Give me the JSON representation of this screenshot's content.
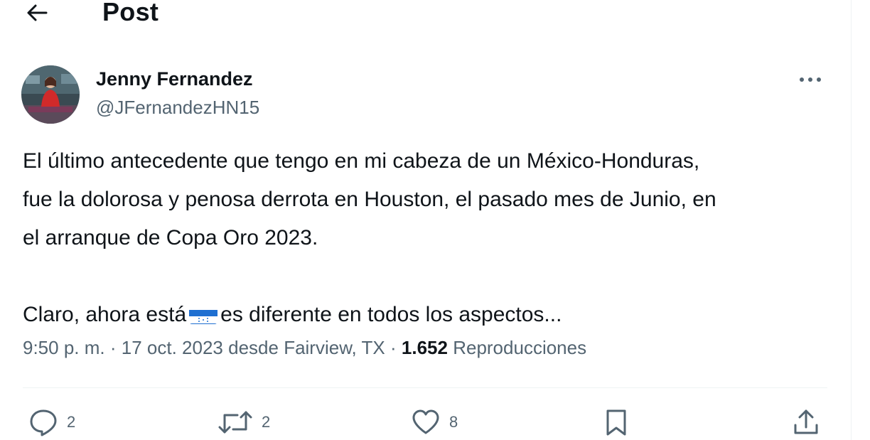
{
  "header": {
    "back_icon": "arrow-left-icon",
    "title": "Post"
  },
  "author": {
    "avatar_icon": "avatar-photo",
    "name": "Jenny Fernandez",
    "handle": "@JFernandezHN15"
  },
  "more_icon": "more-horizontal-icon",
  "tweet": {
    "line1": "El último antecedente que tengo en mi cabeza de un México-Honduras,",
    "line2": "fue la dolorosa y penosa derrota en Houston, el pasado mes de Junio, en",
    "line3": "el arranque de Copa Oro 2023.",
    "line4_before_flag": "Claro, ahora está",
    "flag_icon": "honduras-flag-emoji",
    "line4_after_flag": "es diferente en todos los aspectos..."
  },
  "meta": {
    "time": "9:50 p. m.",
    "separator": "·",
    "date": "17 oct. 2023",
    "source": "desde Fairview, TX",
    "views_count": "1.652",
    "views_label": "Reproducciones"
  },
  "actions": {
    "reply": {
      "icon": "reply-icon",
      "count": "2"
    },
    "repost": {
      "icon": "repost-icon",
      "count": "2"
    },
    "like": {
      "icon": "heart-icon",
      "count": "8"
    },
    "bookmark": {
      "icon": "bookmark-icon"
    },
    "share": {
      "icon": "share-icon"
    }
  },
  "colors": {
    "text_primary": "#0f1419",
    "text_secondary": "#536471",
    "divider": "#eff3f4",
    "flag_blue": "#1e6fd1"
  }
}
